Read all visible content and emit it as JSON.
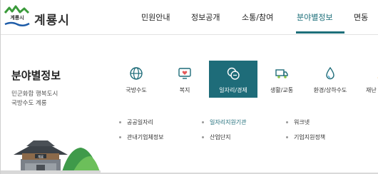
{
  "header": {
    "logo_text": "계룡시",
    "nav": [
      {
        "label": "민원안내"
      },
      {
        "label": "정보공개"
      },
      {
        "label": "소통/참여"
      },
      {
        "label": "분야별정보"
      },
      {
        "label": "면동"
      }
    ]
  },
  "panel": {
    "title": "분야별정보",
    "desc": [
      "민군화합 행복도시",
      "국방수도 계룡"
    ],
    "tiles": [
      {
        "label": "국방수도",
        "icon": "globe-icon"
      },
      {
        "label": "복지",
        "icon": "monitor-heart-icon"
      },
      {
        "label": "일자리/경제",
        "icon": "coins-icon"
      },
      {
        "label": "생활/교통",
        "icon": "truck-icon"
      },
      {
        "label": "환경/상하수도",
        "icon": "water-drop-icon"
      },
      {
        "label": "재난",
        "icon": "alert-icon"
      }
    ],
    "sublinks_row1": [
      "공공일자리",
      "일자리지원기관",
      "워크넷"
    ],
    "sublinks_row2": [
      "관내기업체정보",
      "산업단지",
      "기업지원정책"
    ],
    "scene_sign": "계룡"
  },
  "colors": {
    "accent": "#1e6c79",
    "logo_green": "#3a9a3a"
  }
}
